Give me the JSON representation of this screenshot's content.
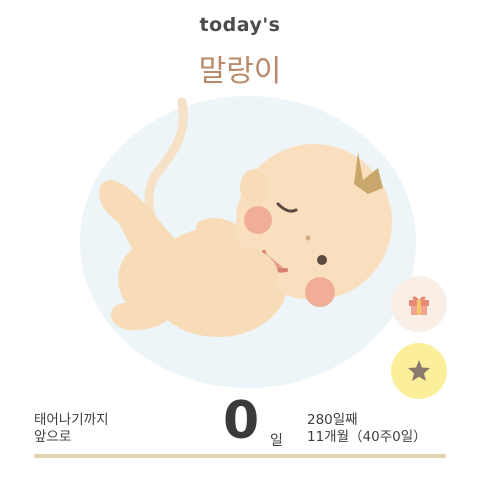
{
  "header": {
    "small_title": "today's",
    "baby_name": "말랑이"
  },
  "actions": {
    "gift_icon": "gift-icon",
    "star_icon": "star-icon"
  },
  "countdown": {
    "label_line1": "태어나기까지",
    "label_line2": "앞으로",
    "days_left": "0",
    "days_unit": "일",
    "total_days": "280일째",
    "duration": "11개월（40주0일）"
  },
  "colors": {
    "name_text": "#b88a6a",
    "womb_bg": "#eef5f8",
    "baby_skin": "#f8dcb7",
    "gift_button_bg": "#f9efe6",
    "star_button_bg": "#fbef9c",
    "divider": "#e3d3ae"
  }
}
